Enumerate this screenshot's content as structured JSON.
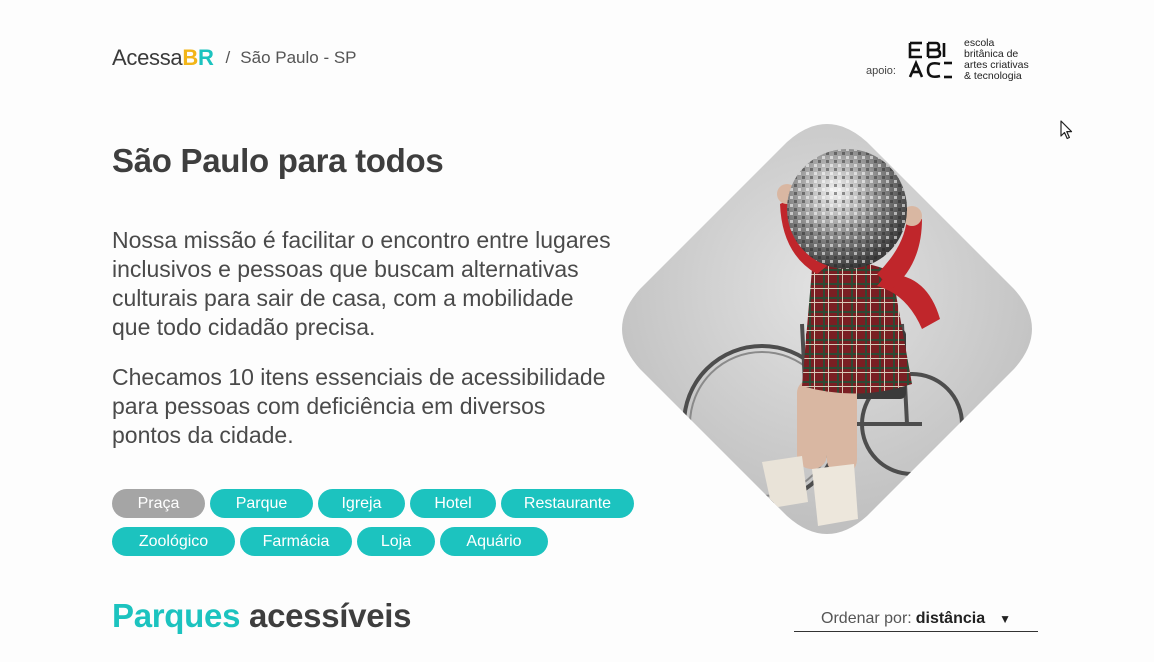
{
  "header": {
    "logo_prefix": "Acessa",
    "logo_b": "B",
    "logo_r": "R",
    "separator": "/",
    "city": "São Paulo - SP"
  },
  "sponsor": {
    "label": "apoio:",
    "lines": [
      "escola",
      "britânica de",
      "artes criativas",
      "& tecnologia"
    ]
  },
  "hero": {
    "title": "São Paulo para todos",
    "paragraph1": "Nossa missão é facilitar o encontro entre lugares inclusivos e pessoas que buscam alternativas culturais para sair de casa, com a mobilidade que todo cidadão precisa.",
    "paragraph2": "Checamos 10 itens essenciais de acessibilidade para pessoas com deficiência em diversos pontos da cidade."
  },
  "categories": {
    "row1": [
      "Praça",
      "Parque",
      "Igreja",
      "Hotel",
      "Restaurante"
    ],
    "row2": [
      "Zoológico",
      "Farmácia",
      "Loja",
      "Aquário"
    ],
    "selected": "Praça"
  },
  "section": {
    "title_accent": "Parques",
    "title_rest": "acessíveis"
  },
  "sort": {
    "label": "Ordenar por:",
    "value": "distância",
    "caret": "▼"
  },
  "colors": {
    "accent": "#1cc3bf",
    "logo_yellow": "#f2b518",
    "chip_selected": "#a5a5a5",
    "text": "#3e3e3e"
  },
  "icons": {
    "cursor": "pointer-cursor-icon",
    "sponsor_logo": "ebac-logo-icon",
    "sort_caret": "caret-down-icon"
  }
}
